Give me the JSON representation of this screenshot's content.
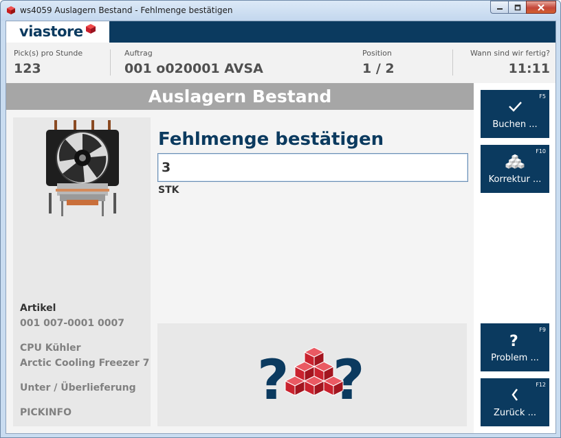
{
  "window": {
    "title": "ws4059 Auslagern Bestand - Fehlmenge bestätigen"
  },
  "brand": {
    "logo_text": "viastore"
  },
  "stats": {
    "picks": {
      "label": "Pick(s) pro Stunde",
      "value": "123"
    },
    "order": {
      "label": "Auftrag",
      "value": "001  o020001  AVSA"
    },
    "position": {
      "label": "Position",
      "value": "1  /  2"
    },
    "finish": {
      "label": "Wann sind wir fertig?",
      "value": "11:11"
    }
  },
  "heading": "Auslagern Bestand",
  "form": {
    "title": "Fehlmenge bestätigen",
    "quantity": "3",
    "unit": "STK"
  },
  "article": {
    "label": "Artikel",
    "number": "001  007-0001  0007",
    "desc1": "CPU Kühler",
    "desc2": "Arctic Cooling Freezer 7",
    "delivery": "Unter / Überlieferung",
    "pickinfo": "PICKINFO"
  },
  "buttons": {
    "book": {
      "label": "Buchen ...",
      "key": "F5",
      "icon": "check-icon"
    },
    "correct": {
      "label": "Korrektur ...",
      "key": "F10",
      "icon": "cubes-icon"
    },
    "problem": {
      "label": "Problem ...",
      "key": "F9",
      "icon": "question-icon"
    },
    "back": {
      "label": "Zurück ...",
      "key": "F12",
      "icon": "chevron-left-icon"
    }
  },
  "colors": {
    "brand_navy": "#0b3a5f",
    "heading_gray": "#a6a6a6",
    "cube_red": "#d5333f"
  }
}
